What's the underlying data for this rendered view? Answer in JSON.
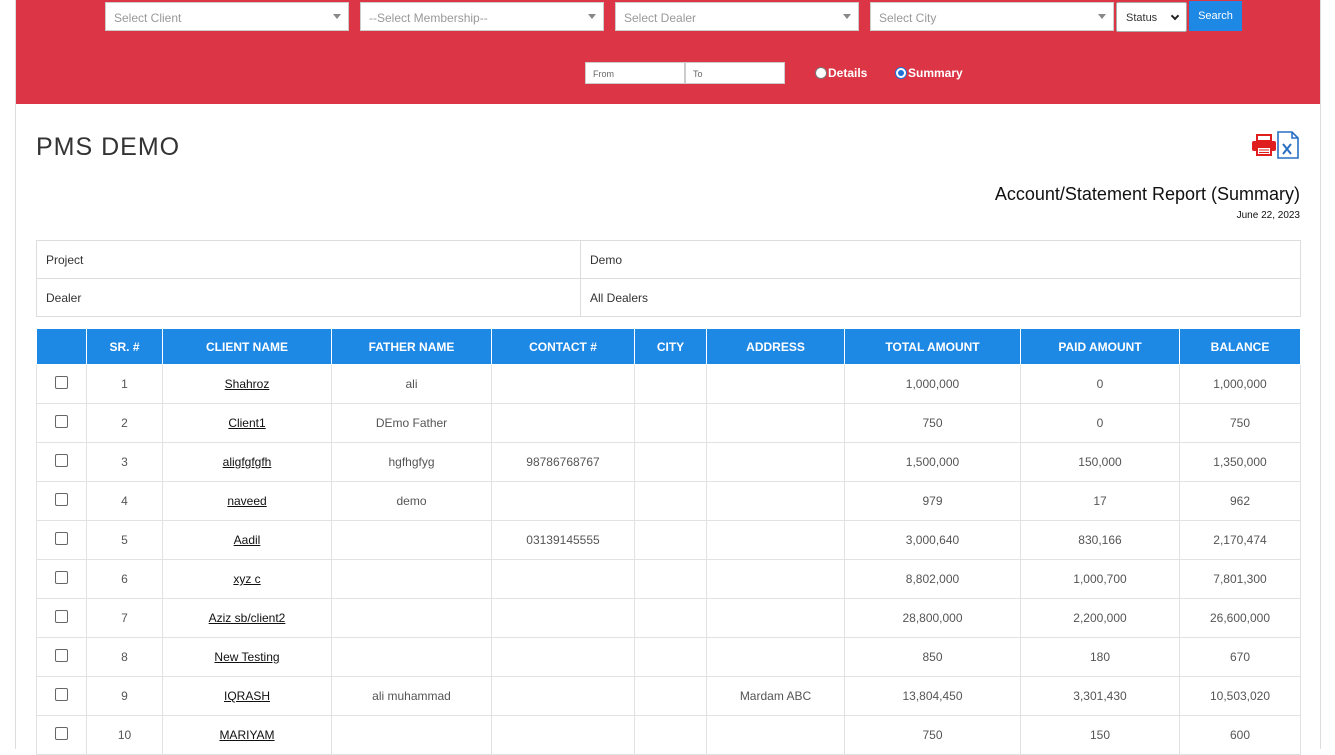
{
  "filters": {
    "client_placeholder": "Select Client",
    "membership_placeholder": "--Select Membership--",
    "dealer_placeholder": "Select Dealer",
    "city_placeholder": "Select City",
    "status_label": "Status",
    "search_label": "Search",
    "from_placeholder": "From",
    "to_placeholder": "To",
    "radio_details": "Details",
    "radio_summary": "Summary",
    "selected_view": "Summary"
  },
  "colors": {
    "filter_bar": "#dc3545",
    "table_header": "#1e88e5",
    "search_button": "#1e88e5",
    "print_icon": "#e01e1e",
    "excel_icon": "#2a6fc4"
  },
  "icons": {
    "print": "printer-icon",
    "excel": "excel-file-icon"
  },
  "page": {
    "title": "PMS DEMO",
    "report_title": "Account/Statement Report (Summary)",
    "report_date": "June 22, 2023"
  },
  "info": {
    "project_label": "Project",
    "project_value": "Demo",
    "dealer_label": "Dealer",
    "dealer_value": "All Dealers"
  },
  "table": {
    "headers": [
      "SR. #",
      "CLIENT NAME",
      "FATHER NAME",
      "CONTACT #",
      "CITY",
      "ADDRESS",
      "TOTAL AMOUNT",
      "PAID AMOUNT",
      "BALANCE"
    ],
    "rows": [
      {
        "sr": "1",
        "client": "Shahroz",
        "father": "ali",
        "contact": "",
        "city": "",
        "address": "",
        "total": "1,000,000",
        "paid": "0",
        "balance": "1,000,000"
      },
      {
        "sr": "2",
        "client": "Client1",
        "father": "DEmo Father",
        "contact": "",
        "city": "",
        "address": "",
        "total": "750",
        "paid": "0",
        "balance": "750"
      },
      {
        "sr": "3",
        "client": "aligfgfgfh",
        "father": "hgfhgfyg",
        "contact": "98786768767",
        "city": "",
        "address": "",
        "total": "1,500,000",
        "paid": "150,000",
        "balance": "1,350,000"
      },
      {
        "sr": "4",
        "client": "naveed",
        "father": "demo",
        "contact": "",
        "city": "",
        "address": "",
        "total": "979",
        "paid": "17",
        "balance": "962"
      },
      {
        "sr": "5",
        "client": "Aadil",
        "father": "",
        "contact": "03139145555",
        "city": "",
        "address": "",
        "total": "3,000,640",
        "paid": "830,166",
        "balance": "2,170,474"
      },
      {
        "sr": "6",
        "client": "xyz c",
        "father": "",
        "contact": "",
        "city": "",
        "address": "",
        "total": "8,802,000",
        "paid": "1,000,700",
        "balance": "7,801,300"
      },
      {
        "sr": "7",
        "client": "Aziz sb/client2",
        "father": "",
        "contact": "",
        "city": "",
        "address": "",
        "total": "28,800,000",
        "paid": "2,200,000",
        "balance": "26,600,000"
      },
      {
        "sr": "8",
        "client": "New Testing",
        "father": "",
        "contact": "",
        "city": "",
        "address": "",
        "total": "850",
        "paid": "180",
        "balance": "670"
      },
      {
        "sr": "9",
        "client": "IQRASH",
        "father": "ali muhammad",
        "contact": "",
        "city": "",
        "address": "Mardam ABC",
        "total": "13,804,450",
        "paid": "3,301,430",
        "balance": "10,503,020"
      },
      {
        "sr": "10",
        "client": "MARIYAM",
        "father": "",
        "contact": "",
        "city": "",
        "address": "",
        "total": "750",
        "paid": "150",
        "balance": "600"
      }
    ]
  }
}
